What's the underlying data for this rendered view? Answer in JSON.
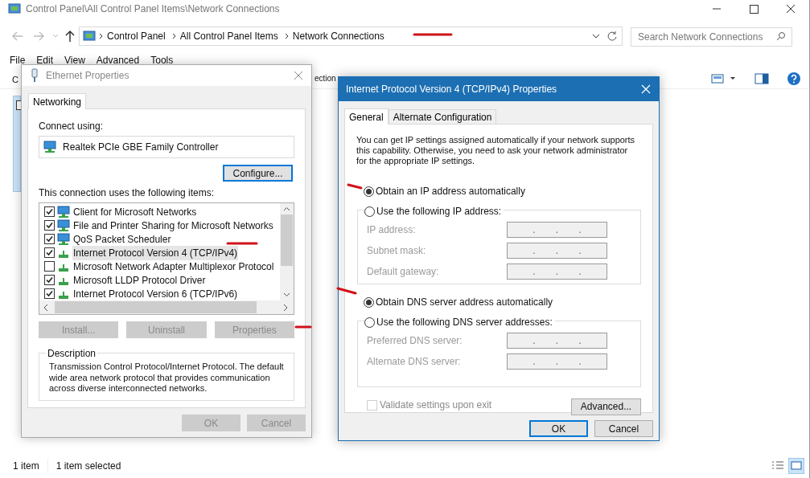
{
  "explorer": {
    "title": "Control Panel\\All Control Panel Items\\Network Connections",
    "breadcrumbs": [
      "Control Panel",
      "All Control Panel Items",
      "Network Connections"
    ],
    "search": {
      "placeholder": "Search Network Connections"
    },
    "menu": [
      "File",
      "Edit",
      "View",
      "Advanced",
      "Tools"
    ],
    "toolbar": [
      "C",
      "ection"
    ],
    "status": [
      "1 item",
      "1 item selected"
    ]
  },
  "ethernet_dialog": {
    "title": "Ethernet Properties",
    "tabs": [
      {
        "label": "Networking",
        "selected": true
      }
    ],
    "connect_label": "Connect using:",
    "adapter": "Realtek PCIe GBE Family Controller",
    "configure_button": "Configure...",
    "items_label": "This connection uses the following items:",
    "items": [
      {
        "label": "Client for Microsoft Networks",
        "checked": true,
        "selected": false,
        "kind": "client"
      },
      {
        "label": "File and Printer Sharing for Microsoft Networks",
        "checked": true,
        "selected": false,
        "kind": "service"
      },
      {
        "label": "QoS Packet Scheduler",
        "checked": true,
        "selected": false,
        "kind": "service"
      },
      {
        "label": "Internet Protocol Version 4 (TCP/IPv4)",
        "checked": true,
        "selected": true,
        "kind": "protocol"
      },
      {
        "label": "Microsoft Network Adapter Multiplexor Protocol",
        "checked": false,
        "selected": false,
        "kind": "protocol"
      },
      {
        "label": "Microsoft LLDP Protocol Driver",
        "checked": true,
        "selected": false,
        "kind": "protocol"
      },
      {
        "label": "Internet Protocol Version 6 (TCP/IPv6)",
        "checked": true,
        "selected": false,
        "kind": "protocol"
      }
    ],
    "item_buttons": [
      {
        "label": "Install...",
        "disabled": true
      },
      {
        "label": "Uninstall",
        "disabled": true
      },
      {
        "label": "Properties",
        "disabled": true
      }
    ],
    "description_label": "Description",
    "description": "Transmission Control Protocol/Internet Protocol. The default wide area network protocol that provides communication across diverse interconnected networks.",
    "footer_buttons": [
      {
        "label": "OK",
        "disabled": true
      },
      {
        "label": "Cancel",
        "disabled": true
      }
    ]
  },
  "ipv4_dialog": {
    "title": "Internet Protocol Version 4 (TCP/IPv4) Properties",
    "tabs": [
      {
        "label": "General",
        "selected": true
      },
      {
        "label": "Alternate Configuration",
        "selected": false
      }
    ],
    "intro": "You can get IP settings assigned automatically if your network supports this capability. Otherwise, you need to ask your network administrator for the appropriate IP settings.",
    "ip_options": [
      {
        "label": "Obtain an IP address automatically",
        "selected": true
      },
      {
        "label": "Use the following IP address:",
        "selected": false
      }
    ],
    "ip_fields": [
      {
        "label": "IP address:",
        "value": ". . .",
        "disabled": true
      },
      {
        "label": "Subnet mask:",
        "value": ". . .",
        "disabled": true
      },
      {
        "label": "Default gateway:",
        "value": ". . .",
        "disabled": true
      }
    ],
    "dns_options": [
      {
        "label": "Obtain DNS server address automatically",
        "selected": true
      },
      {
        "label": "Use the following DNS server addresses:",
        "selected": false
      }
    ],
    "dns_fields": [
      {
        "label": "Preferred DNS server:",
        "value": ". . .",
        "disabled": true
      },
      {
        "label": "Alternate DNS server:",
        "value": ". . .",
        "disabled": true
      }
    ],
    "validate": {
      "label": "Validate settings upon exit",
      "checked": false,
      "disabled": true
    },
    "advanced_button": "Advanced...",
    "footer_buttons": [
      {
        "label": "OK",
        "default": true
      },
      {
        "label": "Cancel",
        "default": false
      }
    ]
  }
}
